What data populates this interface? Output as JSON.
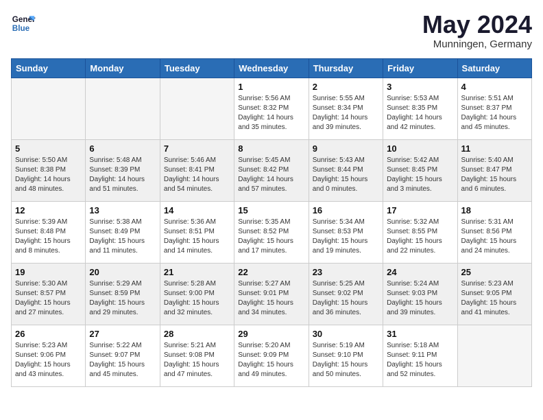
{
  "logo": {
    "line1": "General",
    "line2": "Blue"
  },
  "title": "May 2024",
  "location": "Munningen, Germany",
  "days_of_week": [
    "Sunday",
    "Monday",
    "Tuesday",
    "Wednesday",
    "Thursday",
    "Friday",
    "Saturday"
  ],
  "weeks": [
    [
      {
        "day": "",
        "info": "",
        "empty": true
      },
      {
        "day": "",
        "info": "",
        "empty": true
      },
      {
        "day": "",
        "info": "",
        "empty": true
      },
      {
        "day": "1",
        "info": "Sunrise: 5:56 AM\nSunset: 8:32 PM\nDaylight: 14 hours\nand 35 minutes.",
        "empty": false
      },
      {
        "day": "2",
        "info": "Sunrise: 5:55 AM\nSunset: 8:34 PM\nDaylight: 14 hours\nand 39 minutes.",
        "empty": false
      },
      {
        "day": "3",
        "info": "Sunrise: 5:53 AM\nSunset: 8:35 PM\nDaylight: 14 hours\nand 42 minutes.",
        "empty": false
      },
      {
        "day": "4",
        "info": "Sunrise: 5:51 AM\nSunset: 8:37 PM\nDaylight: 14 hours\nand 45 minutes.",
        "empty": false
      }
    ],
    [
      {
        "day": "5",
        "info": "Sunrise: 5:50 AM\nSunset: 8:38 PM\nDaylight: 14 hours\nand 48 minutes.",
        "empty": false,
        "shaded": true
      },
      {
        "day": "6",
        "info": "Sunrise: 5:48 AM\nSunset: 8:39 PM\nDaylight: 14 hours\nand 51 minutes.",
        "empty": false,
        "shaded": true
      },
      {
        "day": "7",
        "info": "Sunrise: 5:46 AM\nSunset: 8:41 PM\nDaylight: 14 hours\nand 54 minutes.",
        "empty": false,
        "shaded": true
      },
      {
        "day": "8",
        "info": "Sunrise: 5:45 AM\nSunset: 8:42 PM\nDaylight: 14 hours\nand 57 minutes.",
        "empty": false,
        "shaded": true
      },
      {
        "day": "9",
        "info": "Sunrise: 5:43 AM\nSunset: 8:44 PM\nDaylight: 15 hours\nand 0 minutes.",
        "empty": false,
        "shaded": true
      },
      {
        "day": "10",
        "info": "Sunrise: 5:42 AM\nSunset: 8:45 PM\nDaylight: 15 hours\nand 3 minutes.",
        "empty": false,
        "shaded": true
      },
      {
        "day": "11",
        "info": "Sunrise: 5:40 AM\nSunset: 8:47 PM\nDaylight: 15 hours\nand 6 minutes.",
        "empty": false,
        "shaded": true
      }
    ],
    [
      {
        "day": "12",
        "info": "Sunrise: 5:39 AM\nSunset: 8:48 PM\nDaylight: 15 hours\nand 8 minutes.",
        "empty": false
      },
      {
        "day": "13",
        "info": "Sunrise: 5:38 AM\nSunset: 8:49 PM\nDaylight: 15 hours\nand 11 minutes.",
        "empty": false
      },
      {
        "day": "14",
        "info": "Sunrise: 5:36 AM\nSunset: 8:51 PM\nDaylight: 15 hours\nand 14 minutes.",
        "empty": false
      },
      {
        "day": "15",
        "info": "Sunrise: 5:35 AM\nSunset: 8:52 PM\nDaylight: 15 hours\nand 17 minutes.",
        "empty": false
      },
      {
        "day": "16",
        "info": "Sunrise: 5:34 AM\nSunset: 8:53 PM\nDaylight: 15 hours\nand 19 minutes.",
        "empty": false
      },
      {
        "day": "17",
        "info": "Sunrise: 5:32 AM\nSunset: 8:55 PM\nDaylight: 15 hours\nand 22 minutes.",
        "empty": false
      },
      {
        "day": "18",
        "info": "Sunrise: 5:31 AM\nSunset: 8:56 PM\nDaylight: 15 hours\nand 24 minutes.",
        "empty": false
      }
    ],
    [
      {
        "day": "19",
        "info": "Sunrise: 5:30 AM\nSunset: 8:57 PM\nDaylight: 15 hours\nand 27 minutes.",
        "empty": false,
        "shaded": true
      },
      {
        "day": "20",
        "info": "Sunrise: 5:29 AM\nSunset: 8:59 PM\nDaylight: 15 hours\nand 29 minutes.",
        "empty": false,
        "shaded": true
      },
      {
        "day": "21",
        "info": "Sunrise: 5:28 AM\nSunset: 9:00 PM\nDaylight: 15 hours\nand 32 minutes.",
        "empty": false,
        "shaded": true
      },
      {
        "day": "22",
        "info": "Sunrise: 5:27 AM\nSunset: 9:01 PM\nDaylight: 15 hours\nand 34 minutes.",
        "empty": false,
        "shaded": true
      },
      {
        "day": "23",
        "info": "Sunrise: 5:25 AM\nSunset: 9:02 PM\nDaylight: 15 hours\nand 36 minutes.",
        "empty": false,
        "shaded": true
      },
      {
        "day": "24",
        "info": "Sunrise: 5:24 AM\nSunset: 9:03 PM\nDaylight: 15 hours\nand 39 minutes.",
        "empty": false,
        "shaded": true
      },
      {
        "day": "25",
        "info": "Sunrise: 5:23 AM\nSunset: 9:05 PM\nDaylight: 15 hours\nand 41 minutes.",
        "empty": false,
        "shaded": true
      }
    ],
    [
      {
        "day": "26",
        "info": "Sunrise: 5:23 AM\nSunset: 9:06 PM\nDaylight: 15 hours\nand 43 minutes.",
        "empty": false
      },
      {
        "day": "27",
        "info": "Sunrise: 5:22 AM\nSunset: 9:07 PM\nDaylight: 15 hours\nand 45 minutes.",
        "empty": false
      },
      {
        "day": "28",
        "info": "Sunrise: 5:21 AM\nSunset: 9:08 PM\nDaylight: 15 hours\nand 47 minutes.",
        "empty": false
      },
      {
        "day": "29",
        "info": "Sunrise: 5:20 AM\nSunset: 9:09 PM\nDaylight: 15 hours\nand 49 minutes.",
        "empty": false
      },
      {
        "day": "30",
        "info": "Sunrise: 5:19 AM\nSunset: 9:10 PM\nDaylight: 15 hours\nand 50 minutes.",
        "empty": false
      },
      {
        "day": "31",
        "info": "Sunrise: 5:18 AM\nSunset: 9:11 PM\nDaylight: 15 hours\nand 52 minutes.",
        "empty": false
      },
      {
        "day": "",
        "info": "",
        "empty": true
      }
    ]
  ]
}
